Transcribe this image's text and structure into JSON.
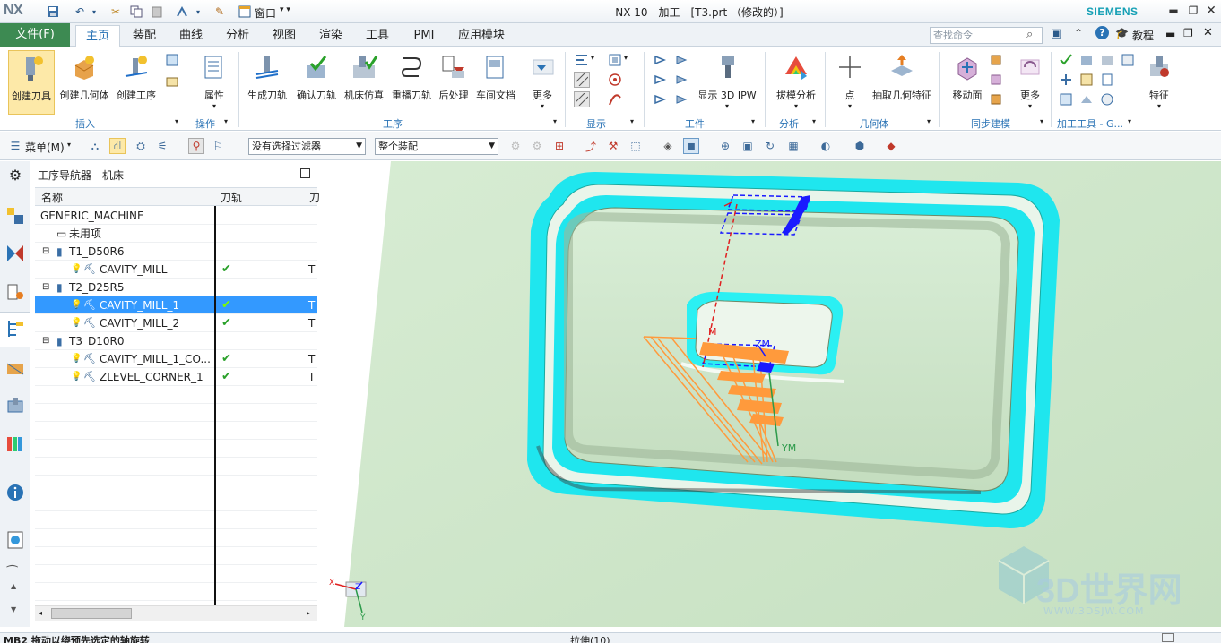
{
  "app": {
    "logo": "NX",
    "title": "NX 10 - 加工 - [T3.prt （修改的）]",
    "brand": "SIEMENS",
    "window_menu": "窗口"
  },
  "tabs": {
    "file": "文件(F)",
    "items": [
      "主页",
      "装配",
      "曲线",
      "分析",
      "视图",
      "渲染",
      "工具",
      "PMI",
      "应用模块"
    ],
    "active": "主页"
  },
  "search": {
    "placeholder": "查找命令"
  },
  "tutorial": "教程",
  "ribbon": {
    "insert": {
      "label": "插入",
      "buttons": [
        "创建刀具",
        "创建几何体",
        "创建工序"
      ]
    },
    "operation": {
      "label": "操作",
      "buttons": [
        "属性"
      ]
    },
    "process": {
      "label": "工序",
      "buttons": [
        "生成刀轨",
        "确认刀轨",
        "机床仿真",
        "重播刀轨",
        "后处理",
        "车间文档",
        "更多"
      ]
    },
    "display": {
      "label": "显示"
    },
    "workpiece": {
      "label": "工件",
      "buttons": [
        "显示 3D IPW"
      ]
    },
    "analysis": {
      "label": "分析",
      "buttons": [
        "拔模分析"
      ]
    },
    "geometry": {
      "label": "几何体",
      "buttons": [
        "点",
        "抽取几何特征"
      ]
    },
    "sync": {
      "label": "同步建模",
      "buttons": [
        "移动面",
        "更多"
      ]
    },
    "mfg_tools": {
      "label": "加工工具 - G...",
      "buttons": [
        "特征"
      ]
    }
  },
  "toolbar": {
    "menu": "菜单(M)",
    "filter": "没有选择过滤器",
    "assembly": "整个装配"
  },
  "navigator": {
    "title": "工序导航器 - 机床",
    "col_name": "名称",
    "col_path": "刀轨",
    "col_tool": "刀",
    "rows": [
      {
        "name": "GENERIC_MACHINE",
        "level": 0,
        "path": "",
        "tool": ""
      },
      {
        "name": "未用项",
        "level": 1,
        "path": "",
        "tool": ""
      },
      {
        "name": "T1_D50R6",
        "level": 1,
        "path": "",
        "tool": ""
      },
      {
        "name": "CAVITY_MILL",
        "level": 2,
        "path": "✔",
        "tool": "T"
      },
      {
        "name": "T2_D25R5",
        "level": 1,
        "path": "",
        "tool": ""
      },
      {
        "name": "CAVITY_MILL_1",
        "level": 2,
        "path": "✔",
        "tool": "T"
      },
      {
        "name": "CAVITY_MILL_2",
        "level": 2,
        "path": "✔",
        "tool": "T"
      },
      {
        "name": "T3_D10R0",
        "level": 1,
        "path": "",
        "tool": ""
      },
      {
        "name": "CAVITY_MILL_1_CO...",
        "level": 2,
        "path": "✔",
        "tool": "T"
      },
      {
        "name": "ZLEVEL_CORNER_1",
        "level": 2,
        "path": "✔",
        "tool": "T"
      }
    ],
    "selected": "CAVITY_MILL_1"
  },
  "viewport": {
    "labels": {
      "m": "M",
      "zm": "ZM",
      "ym": "YM",
      "x": "X",
      "y": "Y",
      "z": "Z"
    },
    "watermark": {
      "big": "3D世界网",
      "small": "WWW.3DSJW.COM"
    }
  },
  "status": {
    "left": "MB2 拖动以绕预先选定的轴旋转",
    "center": "拉伸(10)"
  },
  "colors": {
    "file_tab": "#3d8a52",
    "accent": "#2a73b5",
    "selection": "#3399ff",
    "part_cyan": "#1fe6ee",
    "toolpath_orange": "#ff9a3c",
    "background_green": "#c9e3c3"
  }
}
